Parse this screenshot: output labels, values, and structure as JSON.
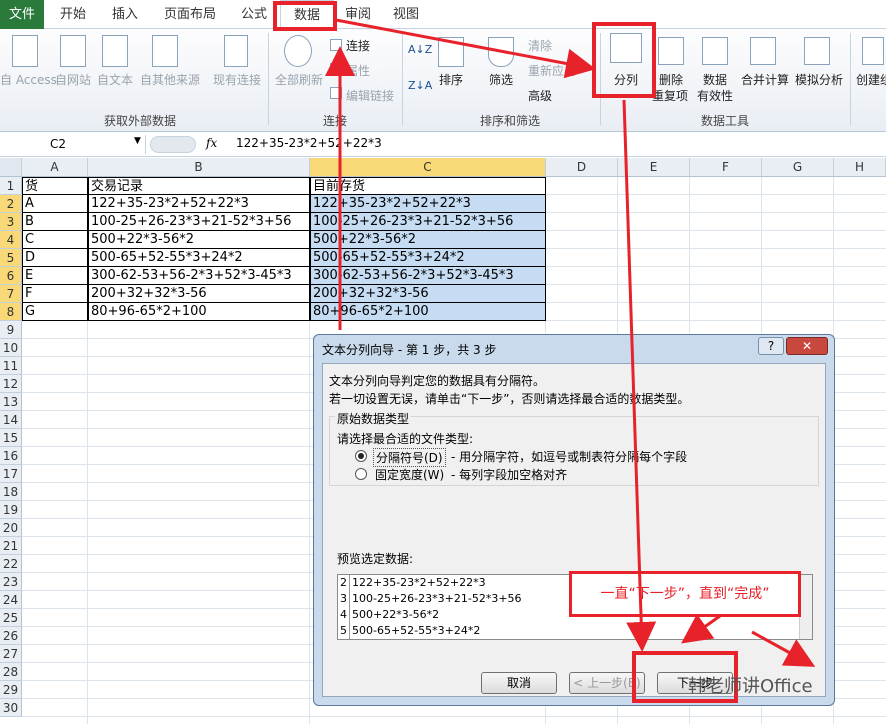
{
  "tabs": [
    "文件",
    "开始",
    "插入",
    "页面布局",
    "公式",
    "数据",
    "审阅",
    "视图"
  ],
  "ribbon": {
    "get_external": {
      "access": "自 Access",
      "web": "自网站",
      "text": "自文本",
      "other": "自其他来源",
      "existing": "现有连接",
      "label": "获取外部数据"
    },
    "connections": {
      "refresh": "全部刷新",
      "connect": "连接",
      "properties": "属性",
      "edit_links": "编辑链接",
      "label": "连接"
    },
    "sort_filter": {
      "az": "A↓Z",
      "za": "Z↓A",
      "sort": "排序",
      "filter": "筛选",
      "clear": "清除",
      "reapply": "重新应用",
      "advanced": "高级",
      "label": "排序和筛选"
    },
    "data_tools": {
      "split": "分列",
      "remove_dup": "删除",
      "remove_dup2": "重复项",
      "validation": "数据",
      "validation2": "有效性",
      "consolidate": "合并计算",
      "whatif": "模拟分析",
      "label": "数据工具"
    },
    "outline": {
      "group": "创建组"
    }
  },
  "formula_bar": {
    "name_box": "C2",
    "fx": "fx",
    "formula": "122+35-23*2+52+22*3"
  },
  "columns": [
    "A",
    "B",
    "C",
    "D",
    "E",
    "F",
    "G",
    "H"
  ],
  "rows": [
    "1",
    "2",
    "3",
    "4",
    "5",
    "6",
    "7",
    "8",
    "9",
    "10",
    "11",
    "12",
    "13",
    "14",
    "15",
    "16",
    "17",
    "18",
    "19",
    "20",
    "21",
    "22",
    "23",
    "24",
    "25",
    "26",
    "27",
    "28",
    "29",
    "30"
  ],
  "sheet": {
    "header": [
      "货",
      "交易记录",
      "目前存货"
    ],
    "data": [
      [
        "A",
        "122+35-23*2+52+22*3",
        "122+35-23*2+52+22*3"
      ],
      [
        "B",
        "100-25+26-23*3+21-52*3+56",
        "100-25+26-23*3+21-52*3+56"
      ],
      [
        "C",
        "500+22*3-56*2",
        "500+22*3-56*2"
      ],
      [
        "D",
        "500-65+52-55*3+24*2",
        "500-65+52-55*3+24*2"
      ],
      [
        "E",
        "300-62-53+56-2*3+52*3-45*3",
        "300-62-53+56-2*3+52*3-45*3"
      ],
      [
        "F",
        "200+32+32*3-56",
        "200+32+32*3-56"
      ],
      [
        "G",
        "80+96-65*2+100",
        "80+96-65*2+100"
      ]
    ]
  },
  "dialog": {
    "title": "文本分列向导 - 第 1 步，共 3 步",
    "help": "?",
    "close": "✕",
    "line1": "文本分列向导判定您的数据具有分隔符。",
    "line2": "若一切设置无误，请单击“下一步”，否则请选择最合适的数据类型。",
    "group_title": "原始数据类型",
    "prompt": "请选择最合适的文件类型:",
    "opt1": "分隔符号(D)",
    "opt1_desc": "- 用分隔字符，如逗号或制表符分隔每个字段",
    "opt2": "固定宽度(W)",
    "opt2_desc": "- 每列字段加空格对齐",
    "preview_label": "预览选定数据:",
    "preview_rows": [
      {
        "n": "2",
        "t": "122+35-23*2+52+22*3"
      },
      {
        "n": "3",
        "t": "100-25+26-23*3+21-52*3+56"
      },
      {
        "n": "4",
        "t": "500+22*3-56*2"
      },
      {
        "n": "5",
        "t": "500-65+52-55*3+24*2"
      }
    ],
    "cancel": "取消",
    "back": "< 上一步(B)",
    "next": "下一步"
  },
  "annotation": {
    "callout": "一直“下一步”，直到“完成”",
    "watermark": "韩老师讲Office"
  },
  "colors": {
    "file_tab": "#2a7a3c",
    "highlight": "#e8222a",
    "selection": "#c5dcf3",
    "header_sel": "#f9d977"
  }
}
